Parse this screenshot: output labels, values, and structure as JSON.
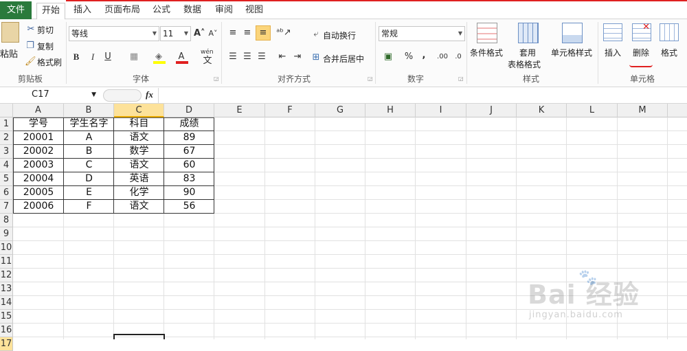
{
  "tabs": [
    "文件",
    "开始",
    "插入",
    "页面布局",
    "公式",
    "数据",
    "审阅",
    "视图"
  ],
  "clipboard": {
    "paste": "粘贴",
    "cut": "剪切",
    "copy": "复制",
    "painter": "格式刷",
    "label": "剪贴板"
  },
  "font": {
    "name": "等线",
    "size": "11",
    "bold": "B",
    "italic": "I",
    "underline": "U",
    "label": "字体",
    "wen": "wén"
  },
  "alignment": {
    "wrap": "自动换行",
    "merge": "合并后居中",
    "label": "对齐方式"
  },
  "number": {
    "format": "常规",
    "percent": "%",
    "comma": ",",
    "label": "数字"
  },
  "styles": {
    "conditional": "条件格式",
    "table_line1": "套用",
    "table_line2": "表格格式",
    "cell_styles": "单元格样式",
    "label": "样式"
  },
  "cells": {
    "insert": "插入",
    "delete": "删除",
    "format": "格式",
    "label": "单元格"
  },
  "formula_bar": {
    "name_box": "C17",
    "fx": "fx"
  },
  "columns": [
    "A",
    "B",
    "C",
    "D",
    "E",
    "F",
    "G",
    "H",
    "I",
    "J",
    "K",
    "L",
    "M"
  ],
  "rows": [
    "1",
    "2",
    "3",
    "4",
    "5",
    "6",
    "7",
    "8",
    "9",
    "10",
    "11",
    "12",
    "13",
    "14",
    "15",
    "16",
    "17"
  ],
  "table": {
    "headers": [
      "学号",
      "学生名字",
      "科目",
      "成绩"
    ],
    "rows": [
      [
        "20001",
        "A",
        "语文",
        "89"
      ],
      [
        "20002",
        "B",
        "数学",
        "67"
      ],
      [
        "20003",
        "C",
        "语文",
        "60"
      ],
      [
        "20004",
        "D",
        "英语",
        "83"
      ],
      [
        "20005",
        "E",
        "化学",
        "90"
      ],
      [
        "20006",
        "F",
        "语文",
        "56"
      ]
    ]
  },
  "watermark": {
    "text": "Bai 经验",
    "url": "jingyan.baidu.com"
  },
  "colors": {
    "file_tab": "#2a7a3c",
    "selected_header": "#fde29a",
    "accent_red": "#e02020"
  }
}
